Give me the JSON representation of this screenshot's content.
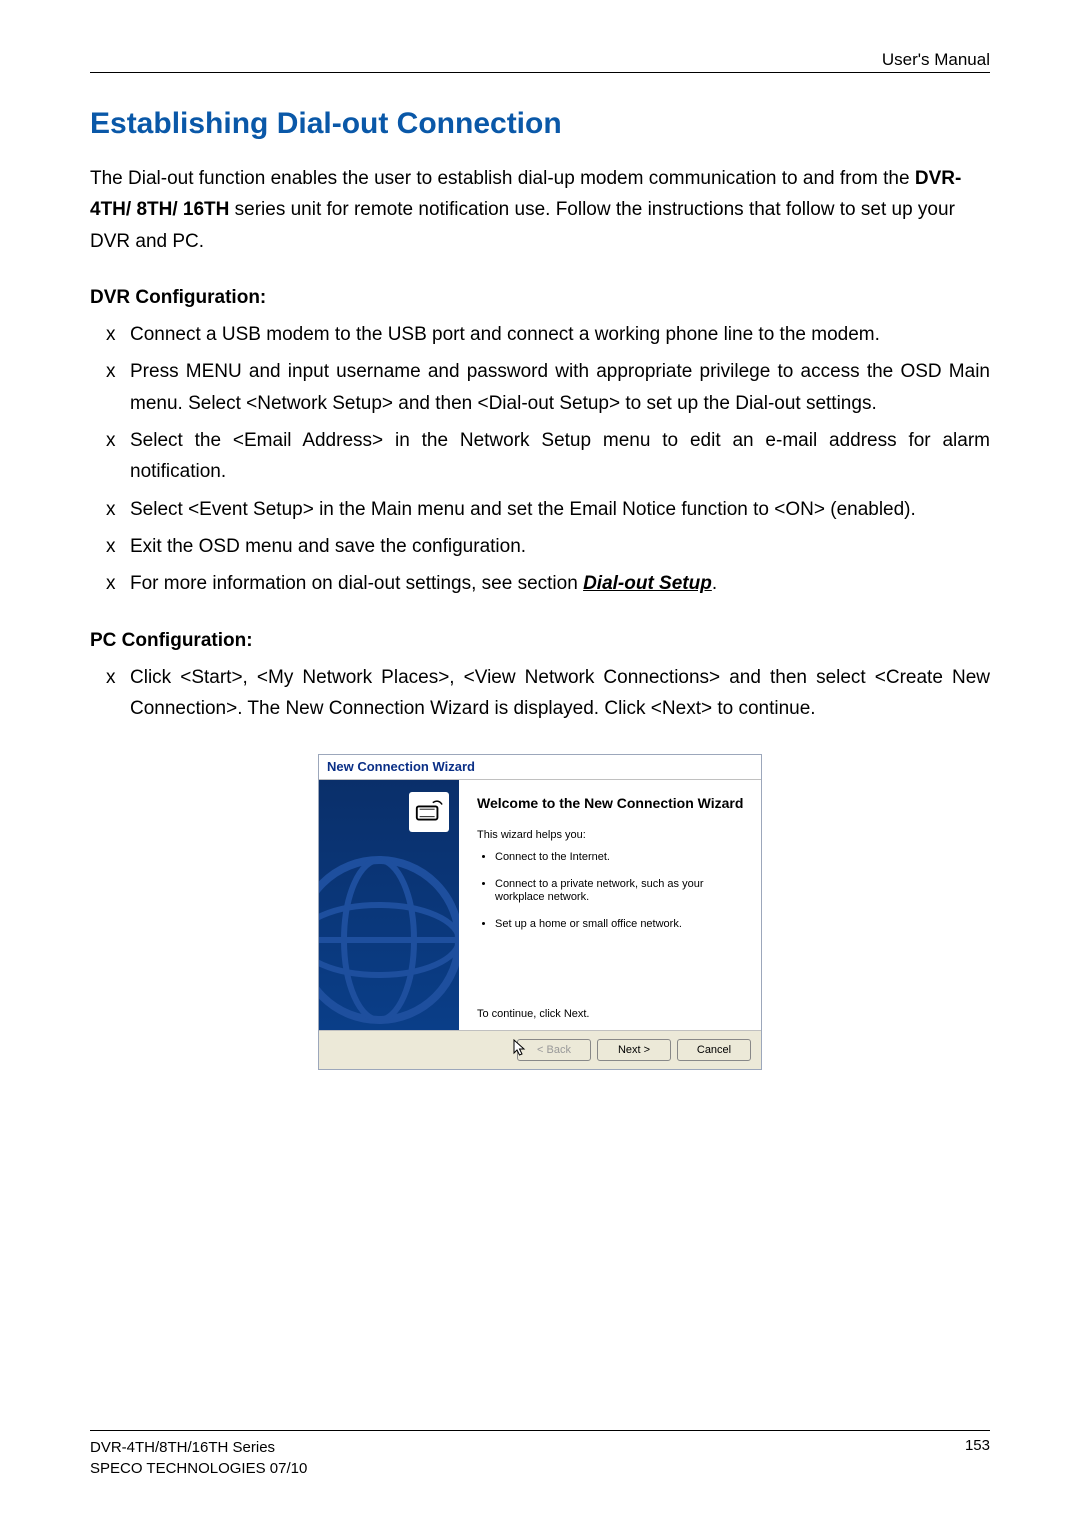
{
  "header": {
    "right": "User's Manual"
  },
  "title": "Establishing Dial-out Connection",
  "intro": {
    "pre": "The Dial-out function enables the user to establish dial-up modem communication to and from the ",
    "bold": "DVR-4TH/ 8TH/ 16TH",
    "post": " series unit for remote notification use. Follow the instructions that follow to set up your DVR and PC."
  },
  "dvr": {
    "heading": "DVR Configuration:",
    "items": [
      "Connect a USB modem to the USB port and connect a working phone line to the modem.",
      "Press MENU and input username and password with appropriate privilege to access the OSD Main menu. Select <Network Setup> and then <Dial-out Setup> to set up the Dial-out settings.",
      "Select the <Email Address> in the Network Setup menu to edit an e-mail address for alarm notification.",
      "Select <Event Setup> in the Main menu and set the Email Notice function to <ON> (enabled).",
      "Exit the OSD menu and save the configuration."
    ],
    "last_pre": "For more information on dial-out settings, see section ",
    "last_link": "Dial-out Setup",
    "last_post": "."
  },
  "pc": {
    "heading": "PC Configuration:",
    "items": [
      "Click <Start>, <My Network Places>, <View Network Connections> and then select <Create New Connection>. The New Connection Wizard is displayed. Click <Next> to continue."
    ]
  },
  "wizard": {
    "title": "New Connection Wizard",
    "welcome": "Welcome to the New Connection Wizard",
    "helps": "This wizard helps you:",
    "bullets": [
      "Connect to the Internet.",
      "Connect to a private network, such as your workplace network.",
      "Set up a home or small office network."
    ],
    "continue": "To continue, click Next.",
    "buttons": {
      "back": "< Back",
      "next": "Next >",
      "cancel": "Cancel"
    }
  },
  "footer": {
    "line1": "DVR-4TH/8TH/16TH Series",
    "line2": "SPECO TECHNOLOGIES 07/10",
    "page": "153"
  }
}
